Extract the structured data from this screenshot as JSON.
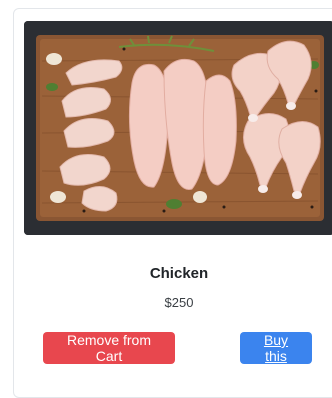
{
  "product": {
    "name": "Chicken",
    "price": "$250",
    "image_alt": "raw-chicken-pieces-on-cutting-board"
  },
  "actions": {
    "remove_label": "Remove from Cart",
    "buy_label": "Buy this"
  },
  "colors": {
    "remove_button": "#e8474e",
    "buy_button": "#3b84ee",
    "image_background": "#2b2e33",
    "cutting_board": "#8a5633"
  }
}
